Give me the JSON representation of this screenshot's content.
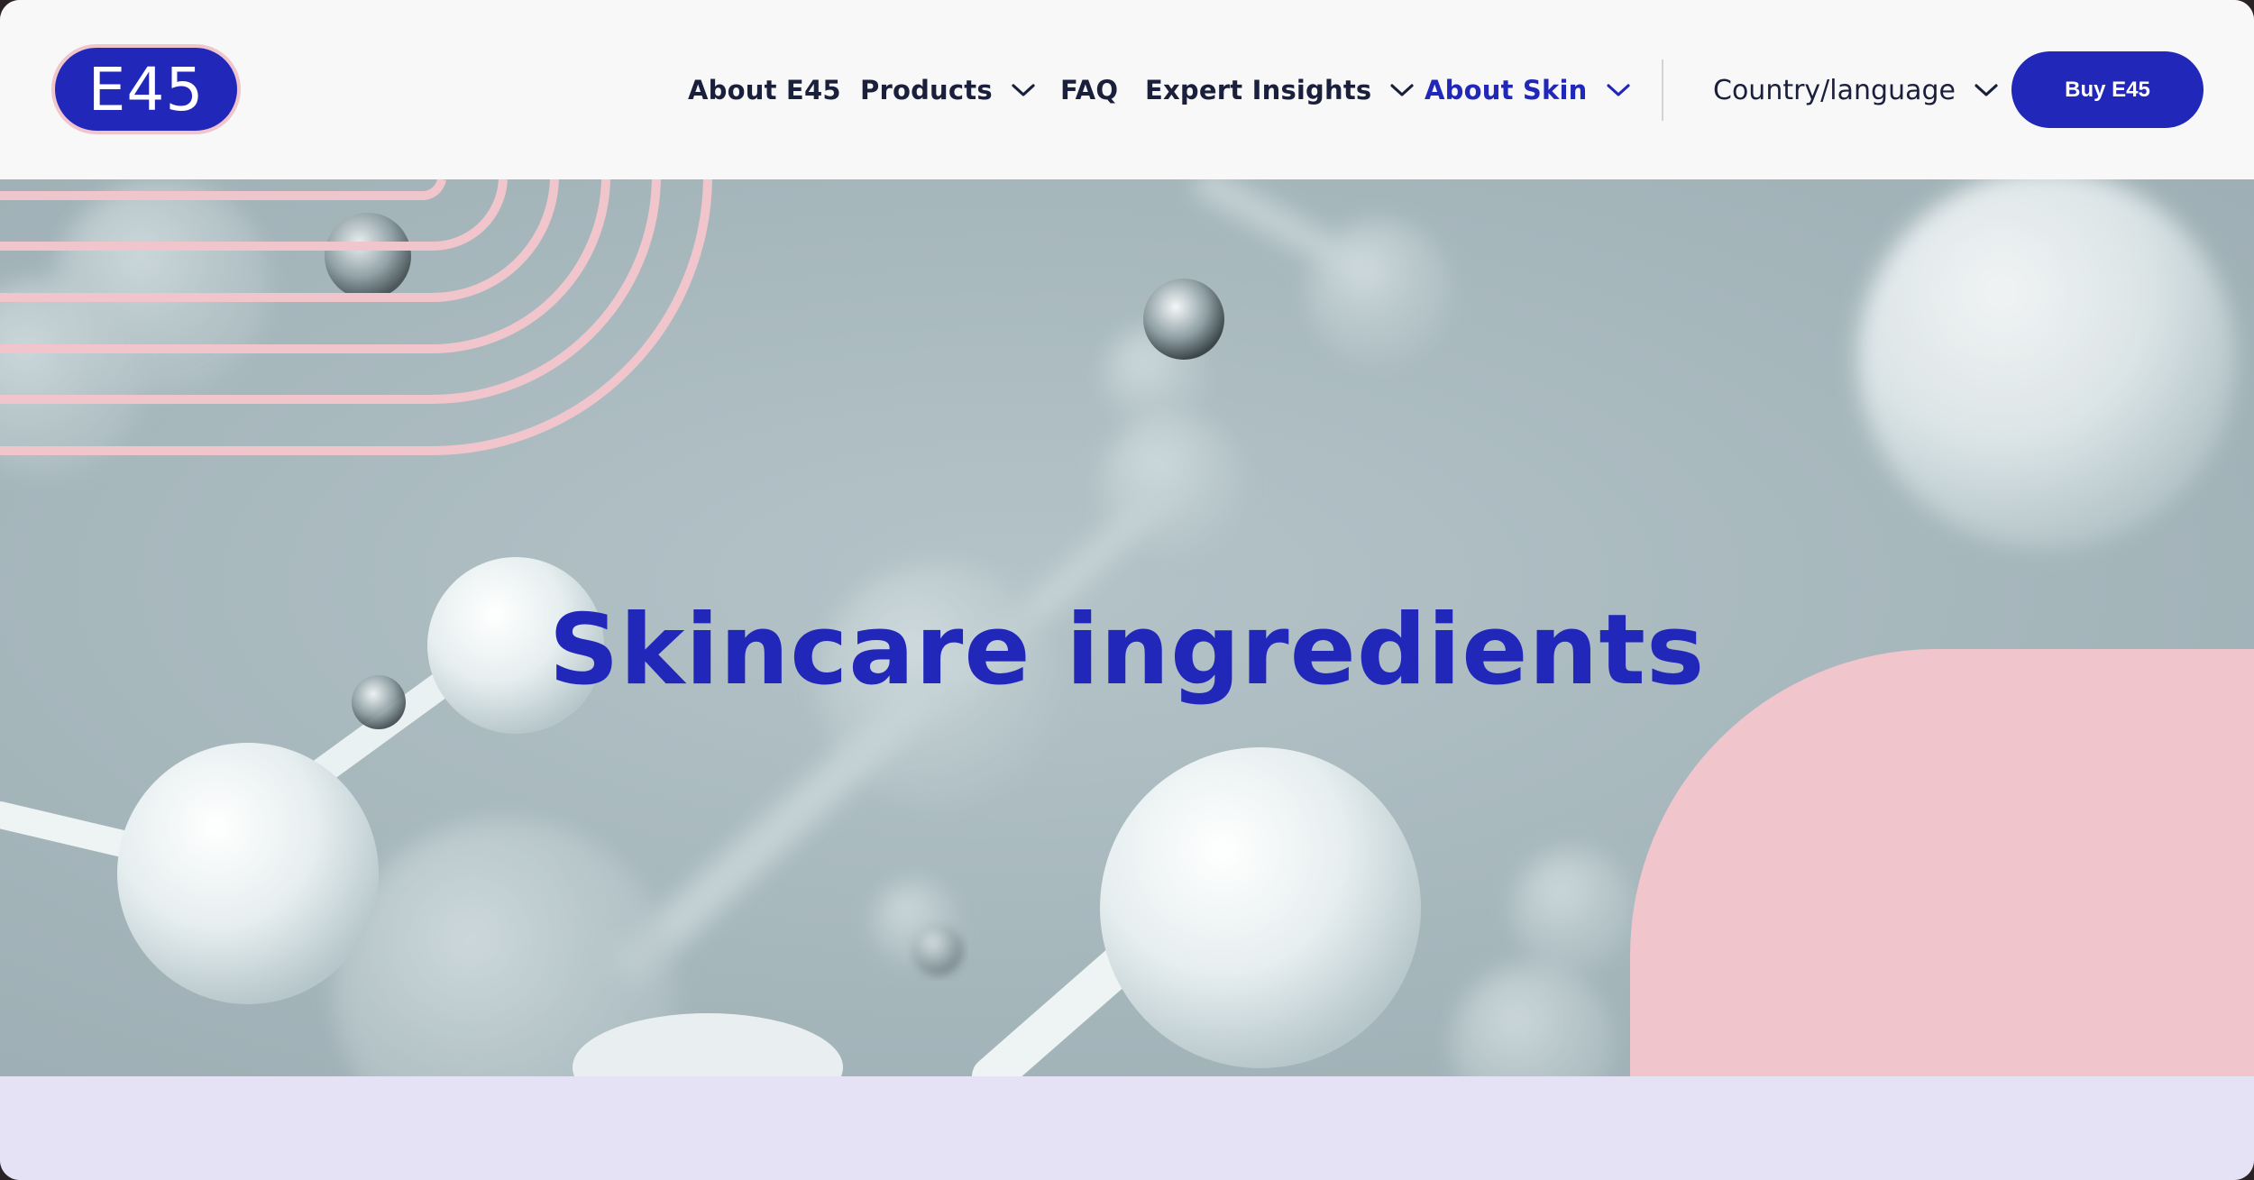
{
  "brand": {
    "logo_text": "E45"
  },
  "nav": {
    "about_e45": "About E45",
    "products": "Products",
    "faq": "FAQ",
    "expert_insights": "Expert Insights",
    "about_skin": "About Skin",
    "country_language": "Country/language",
    "buy": "Buy E45"
  },
  "hero": {
    "title": "Skincare ingredients"
  },
  "icons": {
    "dropdown": "chevron-down-icon"
  },
  "colors": {
    "brand_blue": "#2127b9",
    "accent_pink": "#f1c5cc",
    "header_bg": "#f8f8f9",
    "hero_bg": "#a6b7bc",
    "lower_band": "#e5e2f5"
  }
}
